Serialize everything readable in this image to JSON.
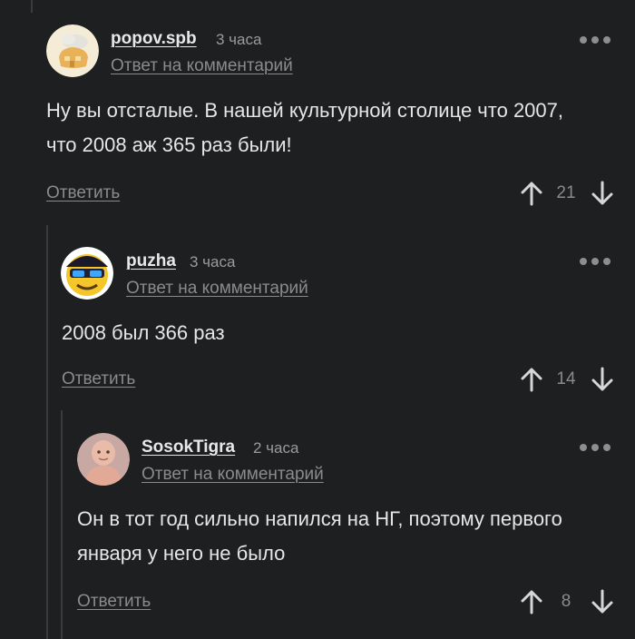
{
  "comments": [
    {
      "username": "popov.spb",
      "time": "3 часа",
      "reply_to": "Ответ на комментарий",
      "text": "Ну вы отсталые. В нашей культурной столице что 2007, что 2008 аж 365 раз были!",
      "reply_label": "Ответить",
      "score": "21"
    },
    {
      "username": "puzha",
      "time": "3 часа",
      "reply_to": "Ответ на комментарий",
      "text": "2008 был 366 раз",
      "reply_label": "Ответить",
      "score": "14"
    },
    {
      "username": "SosokTigra",
      "time": "2 часа",
      "reply_to": "Ответ на комментарий",
      "text": "Он в тот год сильно напился на НГ, поэтому первого января у него не было",
      "reply_label": "Ответить",
      "score": "8"
    }
  ],
  "colors": {
    "background": "#1e1f20",
    "muted": "#8a8b8d",
    "thread_line": "#3a3b3d"
  }
}
